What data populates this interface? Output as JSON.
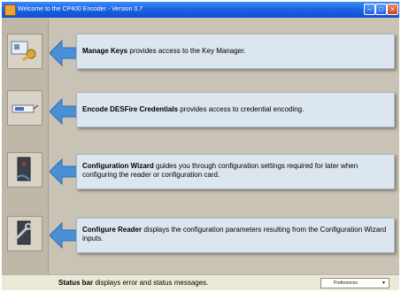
{
  "window": {
    "title": "Welcome to the CP400 Encoder - Version 0.7"
  },
  "tools": [
    {
      "icon": "keys-icon",
      "title": "Manage Keys",
      "desc": " provides access to the Key Manager."
    },
    {
      "icon": "encoder-icon",
      "title": "Encode DESFire Credentials",
      "desc": " provides access to credential encoding."
    },
    {
      "icon": "wizard-icon",
      "title": "Configuration Wizard",
      "desc": " guides you through configuration settings required for later when configuring the reader or configuration card."
    },
    {
      "icon": "reader-config-icon",
      "title": "Configure Reader",
      "desc": " displays the configuration parameters resulting from the Configuration Wizard inputs."
    }
  ],
  "statusbar": {
    "title": "Status bar",
    "desc": " displays error and status messages.",
    "preferences": "Preferences"
  },
  "colors": {
    "titlebar": "#1c64e3",
    "callout_bg": "#dce6ee",
    "arrow": "#4a90d6",
    "panel": "#c9c3b5"
  }
}
